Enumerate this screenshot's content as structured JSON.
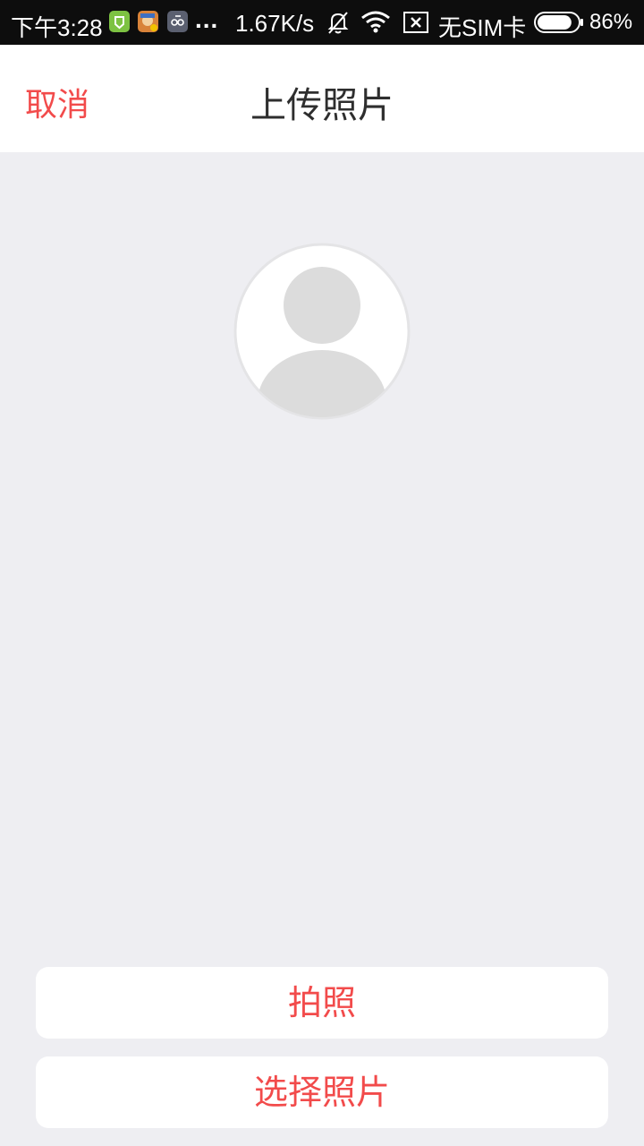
{
  "status_bar": {
    "time": "下午3:28",
    "more_indicator": "...",
    "network_speed": "1.67K/s",
    "sim_status": "无SIM卡",
    "battery_percent": "86%",
    "battery_level": 0.86,
    "icons": [
      "wechat-app-icon",
      "game-app-icon",
      "tool-app-icon",
      "bell-muted-icon",
      "wifi-icon",
      "no-sim-icon",
      "battery-icon"
    ]
  },
  "header": {
    "cancel_label": "取消",
    "title": "上传照片"
  },
  "avatar": {
    "icon": "default-avatar-icon"
  },
  "actions": {
    "take_photo_label": "拍照",
    "choose_photo_label": "选择照片"
  },
  "colors": {
    "accent": "#f24b4b",
    "background": "#eeeef2",
    "status_bar": "#0d0d0d",
    "title_text": "#2e2e2e",
    "card": "#ffffff"
  }
}
